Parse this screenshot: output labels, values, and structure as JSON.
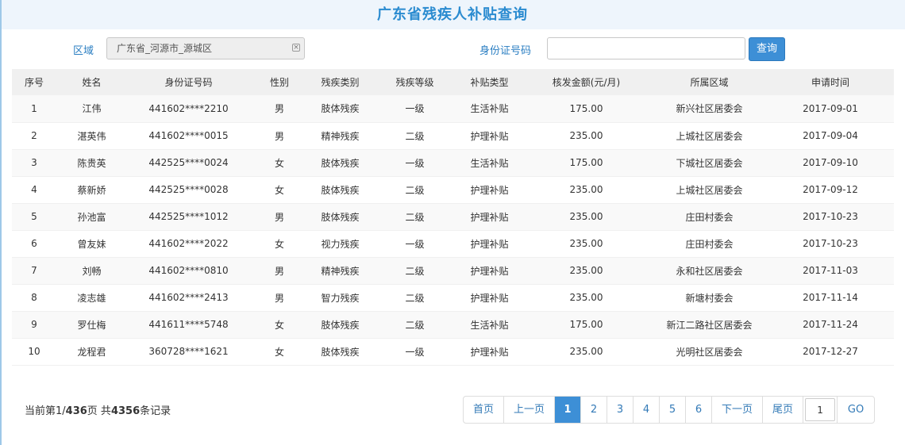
{
  "header": {
    "title": "广东省残疾人补贴查询"
  },
  "filters": {
    "area_label": "区域",
    "area_value": "广东省_河源市_源城区",
    "clear_glyph": "×",
    "id_label": "身份证号码",
    "id_value": "",
    "query_button": "查询"
  },
  "table": {
    "columns": [
      "序号",
      "姓名",
      "身份证号码",
      "性别",
      "残疾类别",
      "残疾等级",
      "补贴类型",
      "核发金额(元/月)",
      "所属区域",
      "申请时间"
    ],
    "rows": [
      [
        "1",
        "江伟",
        "441602****2210",
        "男",
        "肢体残疾",
        "一级",
        "生活补贴",
        "175.00",
        "新兴社区居委会",
        "2017-09-01"
      ],
      [
        "2",
        "湛英伟",
        "441602****0015",
        "男",
        "精神残疾",
        "二级",
        "护理补贴",
        "235.00",
        "上城社区居委会",
        "2017-09-04"
      ],
      [
        "3",
        "陈贵英",
        "442525****0024",
        "女",
        "肢体残疾",
        "一级",
        "生活补贴",
        "175.00",
        "下城社区居委会",
        "2017-09-10"
      ],
      [
        "4",
        "蔡新娇",
        "442525****0028",
        "女",
        "肢体残疾",
        "二级",
        "护理补贴",
        "235.00",
        "上城社区居委会",
        "2017-09-12"
      ],
      [
        "5",
        "孙池富",
        "442525****1012",
        "男",
        "肢体残疾",
        "二级",
        "护理补贴",
        "235.00",
        "庄田村委会",
        "2017-10-23"
      ],
      [
        "6",
        "曾友妹",
        "441602****2022",
        "女",
        "视力残疾",
        "一级",
        "护理补贴",
        "235.00",
        "庄田村委会",
        "2017-10-23"
      ],
      [
        "7",
        "刘畅",
        "441602****0810",
        "男",
        "精神残疾",
        "二级",
        "护理补贴",
        "235.00",
        "永和社区居委会",
        "2017-11-03"
      ],
      [
        "8",
        "凌志雄",
        "441602****2413",
        "男",
        "智力残疾",
        "二级",
        "护理补贴",
        "235.00",
        "新塘村委会",
        "2017-11-14"
      ],
      [
        "9",
        "罗仕梅",
        "441611****5748",
        "女",
        "肢体残疾",
        "二级",
        "生活补贴",
        "175.00",
        "新江二路社区居委会",
        "2017-11-24"
      ],
      [
        "10",
        "龙程君",
        "360728****1621",
        "女",
        "肢体残疾",
        "一级",
        "护理补贴",
        "235.00",
        "光明社区居委会",
        "2017-12-27"
      ]
    ]
  },
  "footer": {
    "prefix": "当前第1/",
    "total_pages": "436",
    "middle": "页 共",
    "total_records": "4356",
    "suffix": "条记录"
  },
  "pagination": {
    "first": "首页",
    "prev": "上一页",
    "pages": [
      "1",
      "2",
      "3",
      "4",
      "5",
      "6"
    ],
    "current": "1",
    "next": "下一页",
    "last": "尾页",
    "jump_value": "1",
    "go": "GO"
  },
  "colors": {
    "accent": "#3d8fd6",
    "title": "#2a8bd0",
    "label": "#2a7ec2"
  }
}
